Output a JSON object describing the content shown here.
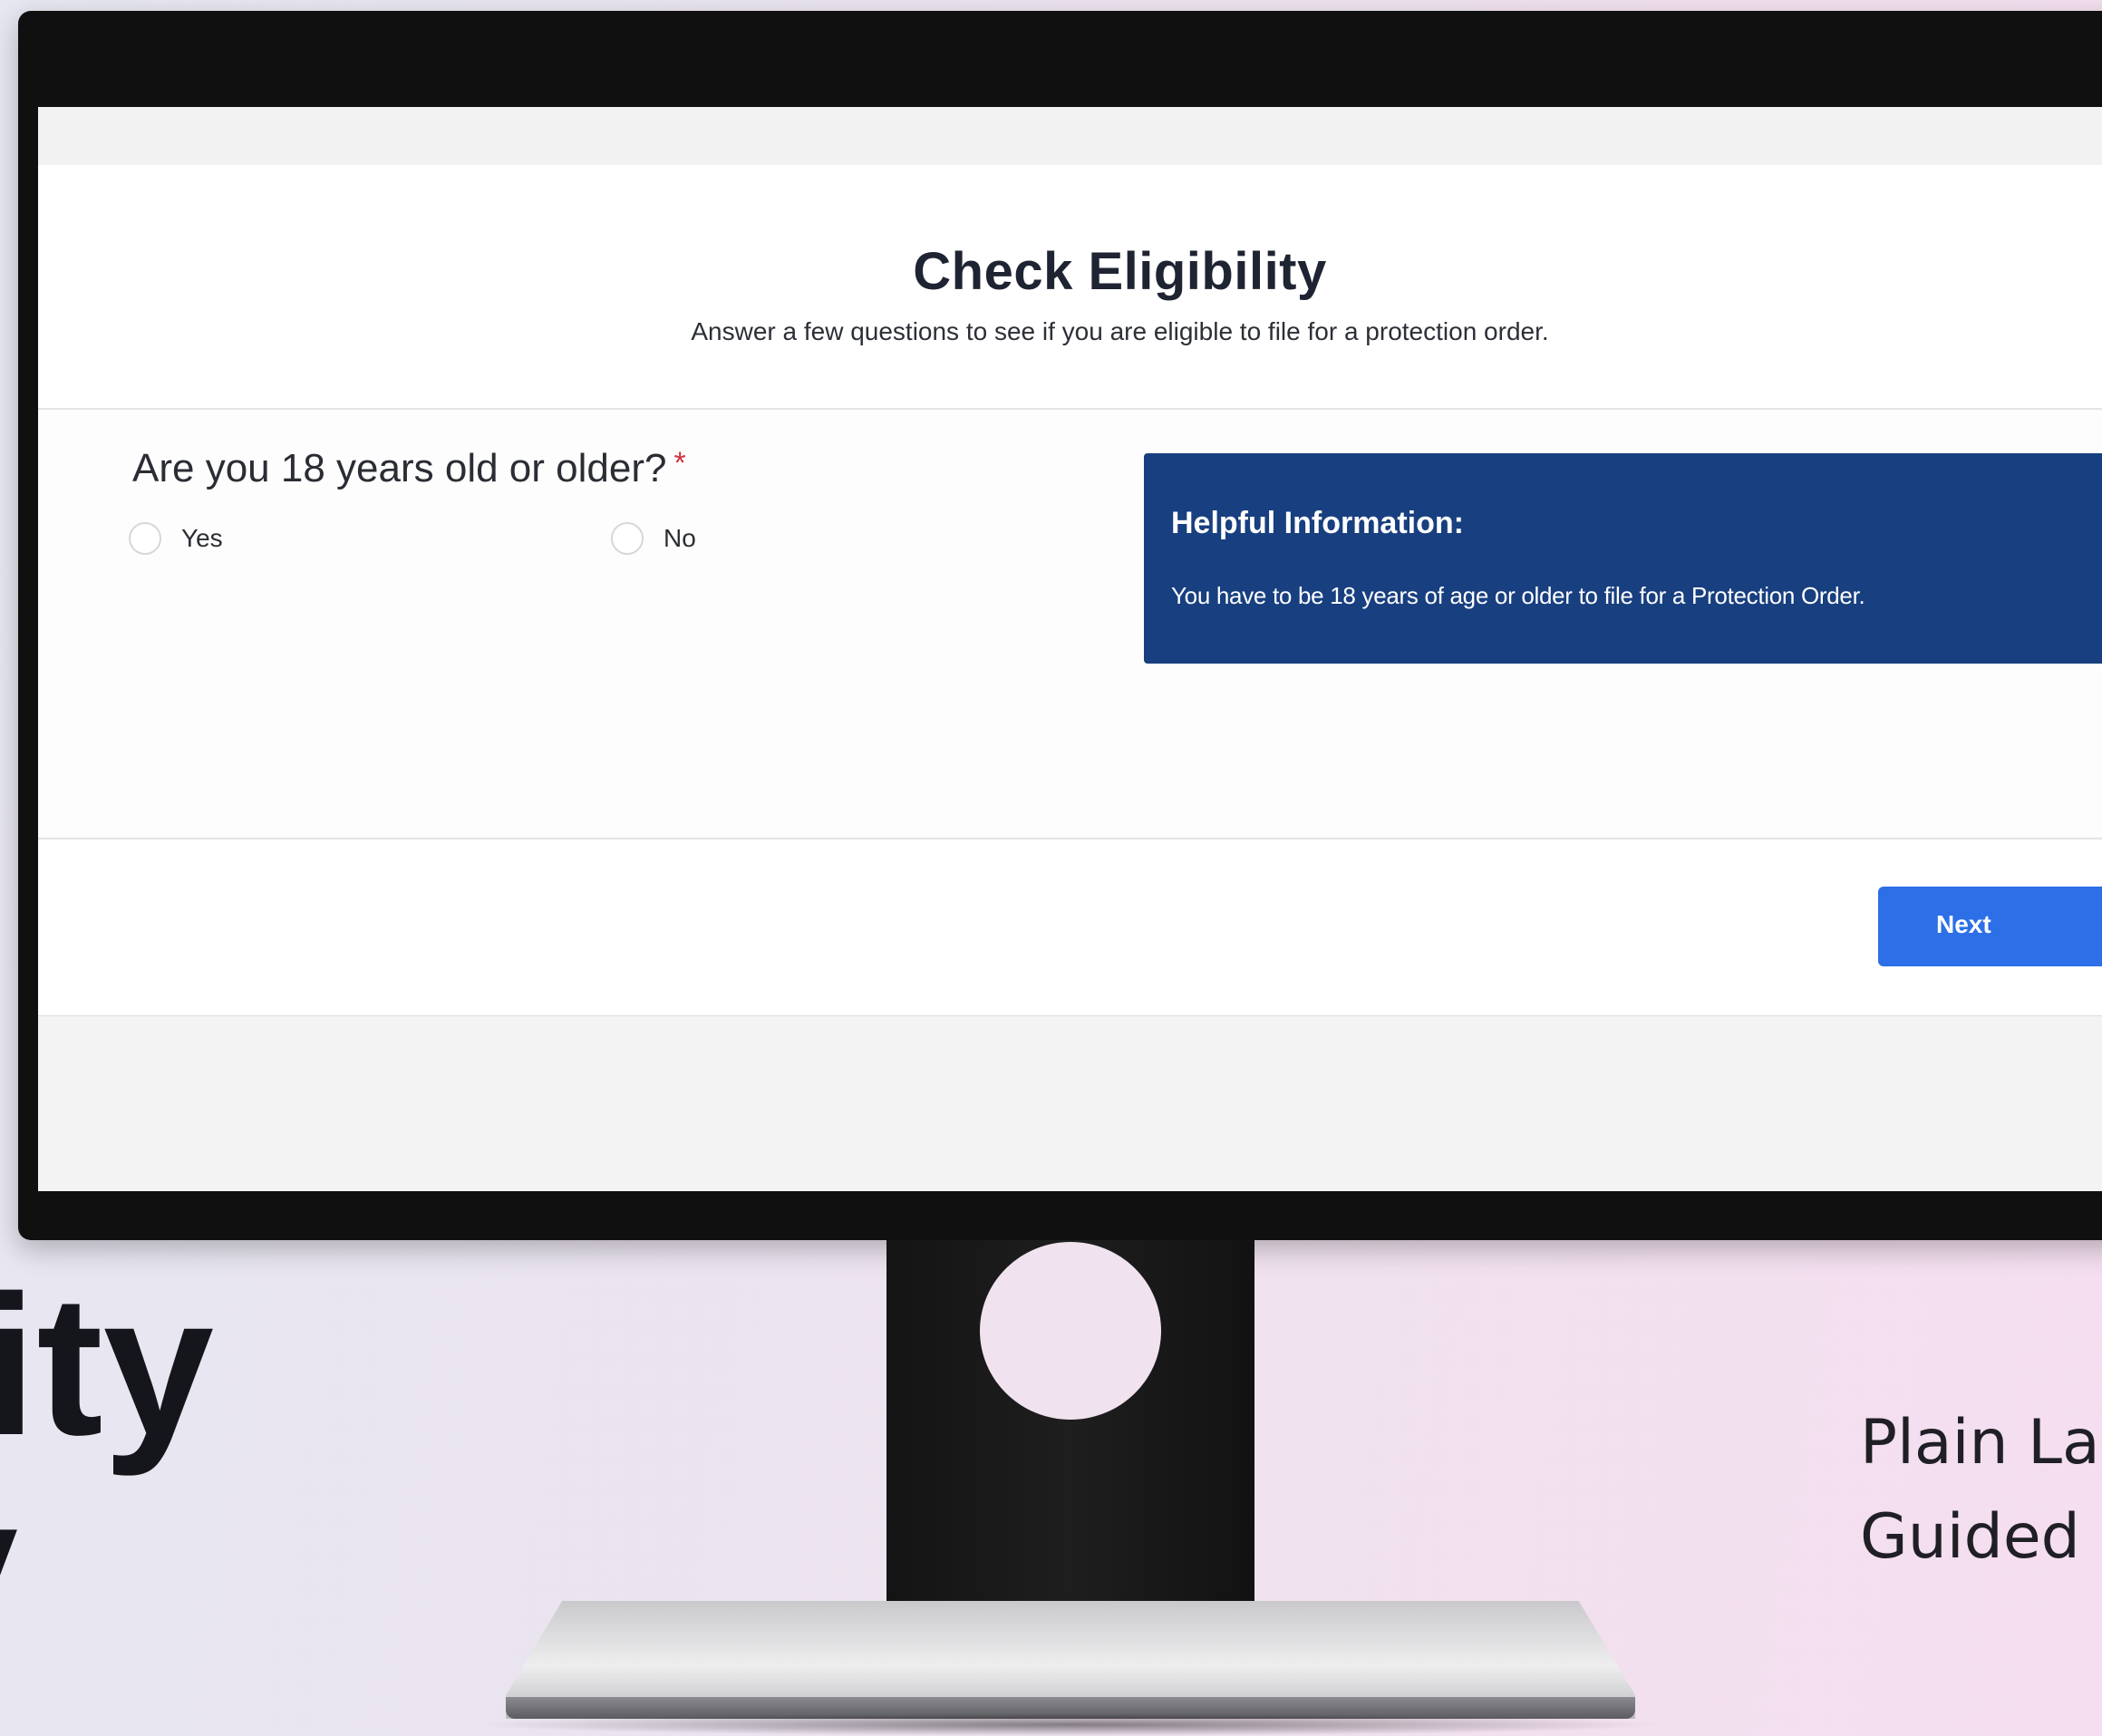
{
  "screen": {
    "title": "Check Eligibility",
    "subtitle": "Answer a few questions to see if you are eligible to file for a protection order.",
    "question": {
      "text": "Are you 18 years old or older?",
      "required_marker": "*",
      "options": [
        {
          "label": "Yes",
          "selected": false
        },
        {
          "label": "No",
          "selected": false
        }
      ]
    },
    "info_box": {
      "title": "Helpful Information:",
      "text": "You have to be 18 years of age or older to file for a Protection Order."
    },
    "next_label": "Next"
  },
  "marketing": {
    "headline_line1": "ity",
    "headline_line2": "y",
    "tagline_line1": "Plain La",
    "tagline_line2": "Guided"
  },
  "colors": {
    "info_box_bg": "#183f7f",
    "next_button_bg": "#2c6fe7",
    "required_star": "#d0333f"
  }
}
